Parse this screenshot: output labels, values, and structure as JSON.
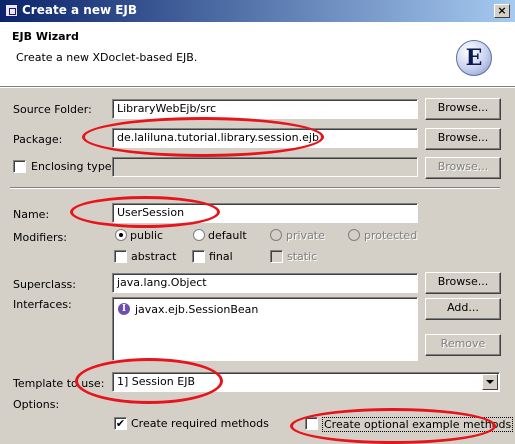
{
  "window": {
    "title": "Create a new EJB",
    "close_glyph": "×"
  },
  "banner": {
    "title": "EJB Wizard",
    "description": "Create a new XDoclet-based EJB.",
    "logo_letter": "E"
  },
  "source_folder": {
    "label": "Source Folder:",
    "value": "LibraryWebEjb/src",
    "button": "Browse..."
  },
  "package": {
    "label": "Package:",
    "value": "de.laliluna.tutorial.library.session.ejb",
    "button": "Browse..."
  },
  "enclosing": {
    "label": "Enclosing type:",
    "value": "",
    "button": "Browse...",
    "checked": false
  },
  "name": {
    "label": "Name:",
    "value": "UserSession"
  },
  "modifiers": {
    "label": "Modifiers:",
    "public": "public",
    "default": "default",
    "private": "private",
    "protected": "protected",
    "abstract": "abstract",
    "final": "final",
    "static": "static"
  },
  "superclass": {
    "label": "Superclass:",
    "value": "java.lang.Object",
    "button": "Browse..."
  },
  "interfaces": {
    "label": "Interfaces:",
    "items": [
      "javax.ejb.SessionBean"
    ],
    "icon_letter": "I",
    "add_button": "Add...",
    "remove_button": "Remove"
  },
  "template": {
    "label": "Template to use:",
    "value": "1] Session EJB"
  },
  "options": {
    "label": "Options:",
    "required": {
      "label": "Create required methods",
      "checked": true
    },
    "optional": {
      "label": "Create optional example methods",
      "checked": false
    }
  },
  "check_glyph": "✔",
  "annotation_color": "#e8141c"
}
